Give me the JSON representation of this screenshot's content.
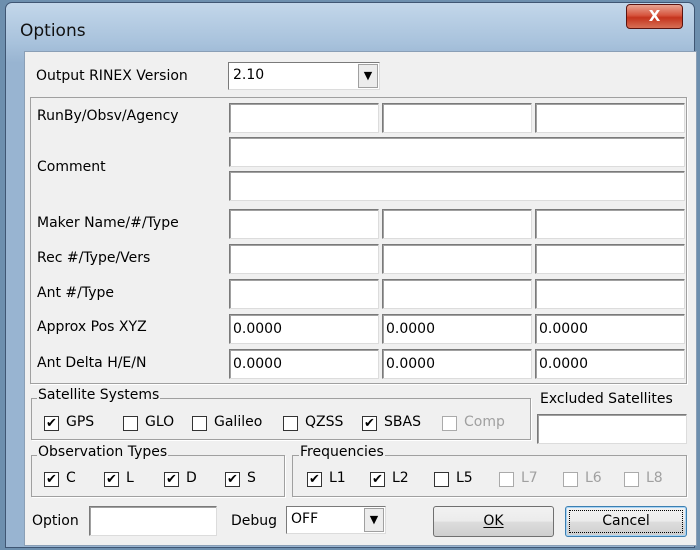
{
  "window": {
    "title": "Options",
    "close_label": "X"
  },
  "rinex": {
    "label": "Output RINEX Version",
    "value": "2.10"
  },
  "header_fields": {
    "runby_label": "RunBy/Obsv/Agency",
    "runby": [
      "",
      "",
      ""
    ],
    "comment_label": "Comment",
    "comment": [
      "",
      ""
    ],
    "maker_label": "Maker Name/#/Type",
    "maker": [
      "",
      "",
      ""
    ],
    "rec_label": "Rec #/Type/Vers",
    "rec": [
      "",
      "",
      ""
    ],
    "ant_label": "Ant #/Type",
    "ant": [
      "",
      "",
      ""
    ],
    "approx_label": "Approx Pos XYZ",
    "approx": [
      "0.0000",
      "0.0000",
      "0.0000"
    ],
    "delta_label": "Ant Delta H/E/N",
    "delta": [
      "0.0000",
      "0.0000",
      "0.0000"
    ]
  },
  "satellite_systems": {
    "title": "Satellite Systems",
    "items": [
      {
        "label": "GPS",
        "checked": true,
        "enabled": true
      },
      {
        "label": "GLO",
        "checked": false,
        "enabled": true
      },
      {
        "label": "Galileo",
        "checked": false,
        "enabled": true
      },
      {
        "label": "QZSS",
        "checked": false,
        "enabled": true
      },
      {
        "label": "SBAS",
        "checked": true,
        "enabled": true
      },
      {
        "label": "Comp",
        "checked": false,
        "enabled": false
      }
    ]
  },
  "excluded": {
    "title": "Excluded Satellites",
    "value": ""
  },
  "observation_types": {
    "title": "Observation Types",
    "items": [
      {
        "label": "C",
        "checked": true
      },
      {
        "label": "L",
        "checked": true
      },
      {
        "label": "D",
        "checked": true
      },
      {
        "label": "S",
        "checked": true
      }
    ]
  },
  "frequencies": {
    "title": "Frequencies",
    "items": [
      {
        "label": "L1",
        "checked": true,
        "enabled": true
      },
      {
        "label": "L2",
        "checked": true,
        "enabled": true
      },
      {
        "label": "L5",
        "checked": false,
        "enabled": true
      },
      {
        "label": "L7",
        "checked": false,
        "enabled": false
      },
      {
        "label": "L6",
        "checked": false,
        "enabled": false
      },
      {
        "label": "L8",
        "checked": false,
        "enabled": false
      }
    ]
  },
  "footer": {
    "option_label": "Option",
    "option_value": "",
    "debug_label": "Debug",
    "debug_value": "OFF",
    "ok_label": "OK",
    "cancel_label": "Cancel"
  },
  "check_mark": "✔"
}
